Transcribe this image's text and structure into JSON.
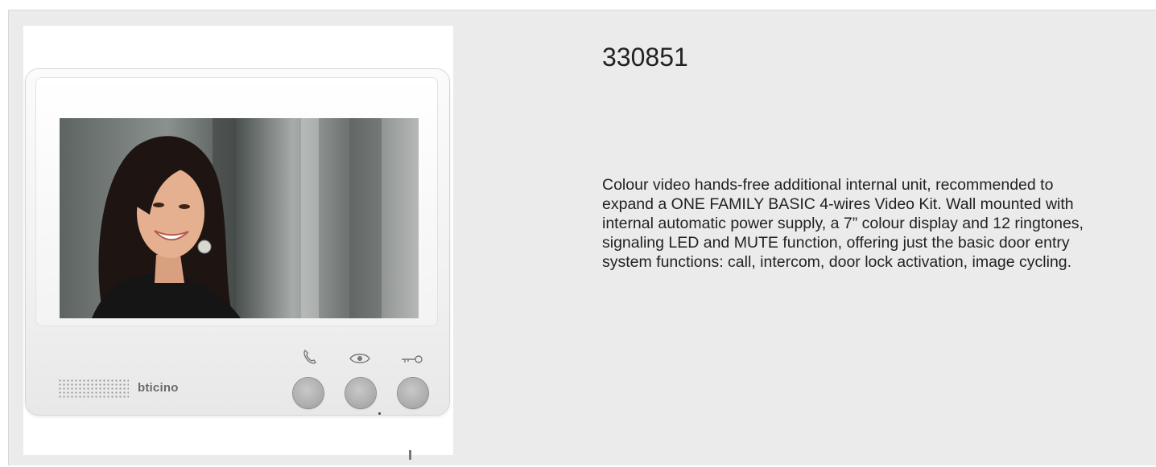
{
  "product": {
    "code": "330851",
    "description": "Colour video hands-free additional internal unit, recommended to expand a ONE FAMILY BASIC 4-wires Video Kit. Wall mounted with internal automatic power supply, a 7” colour display and 12 ringtones, signaling LED and MUTE function, offering just the basic door entry system functions: call, intercom, door lock activation, image cycling."
  },
  "device": {
    "brand": "bticino",
    "buttons": [
      {
        "name": "call",
        "icon": "phone-icon"
      },
      {
        "name": "camera",
        "icon": "eye-icon"
      },
      {
        "name": "door-lock",
        "icon": "key-icon"
      }
    ]
  },
  "colors": {
    "background": "#ebebeb",
    "text": "#222222",
    "button": "#b1b1b1"
  }
}
